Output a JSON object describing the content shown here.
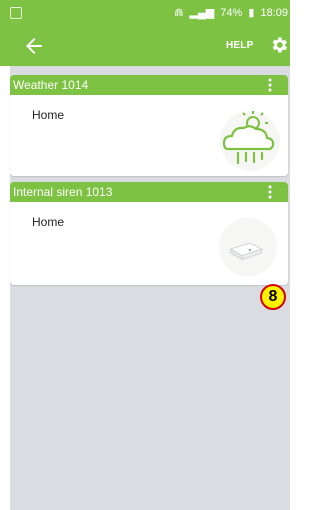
{
  "status": {
    "battery": "74%",
    "time": "18:09"
  },
  "appbar": {
    "help_label": "HELP"
  },
  "cards": [
    {
      "title": "Weather 1014",
      "location": "Home",
      "icon": "weather-icon"
    },
    {
      "title": "Internal siren 1013",
      "location": "Home",
      "icon": "siren-icon"
    }
  ],
  "overlay": {
    "badge_number": "8"
  },
  "colors": {
    "accent": "#7dc243",
    "background": "#d9dde1",
    "badge_fill": "#fff200",
    "badge_border": "#d40000"
  }
}
